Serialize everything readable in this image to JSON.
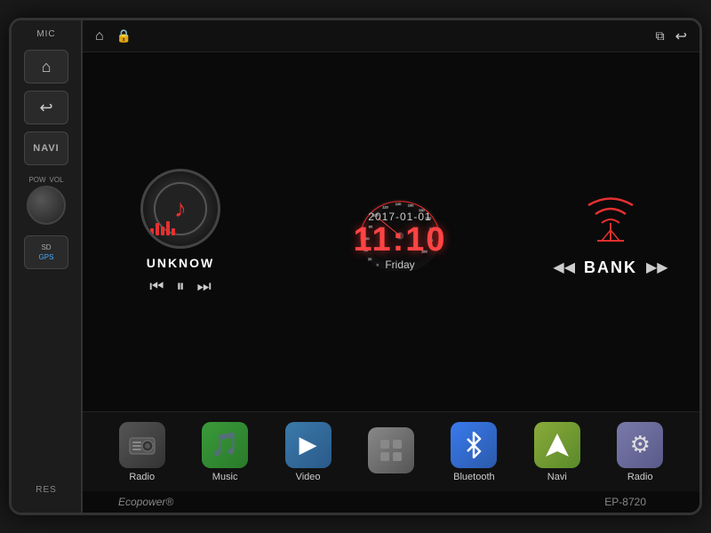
{
  "device": {
    "brand": "Ecopower®",
    "model": "EP-8720"
  },
  "topbar": {
    "left_icons": [
      "⌂",
      "🔒"
    ],
    "right_icons": [
      "⧉",
      "↩"
    ]
  },
  "music": {
    "track_name": "UNKNOW",
    "controls": {
      "prev": "⏮",
      "play": "⏸",
      "next": "⏭"
    }
  },
  "clock": {
    "date": "2017-01-01",
    "time": "11:10",
    "day": "Friday"
  },
  "radio": {
    "station": "BANK",
    "prev": "◀◀",
    "next": "▶▶"
  },
  "apps": [
    {
      "id": "radio",
      "label": "Radio",
      "icon": "📻"
    },
    {
      "id": "music",
      "label": "Music",
      "icon": "🎵"
    },
    {
      "id": "video",
      "label": "Video",
      "icon": "📹"
    },
    {
      "id": "apps",
      "label": "",
      "icon": "⊞"
    },
    {
      "id": "bluetooth",
      "label": "Bluetooth",
      "icon": "⚡"
    },
    {
      "id": "navi",
      "label": "Navi",
      "icon": "🧭"
    },
    {
      "id": "settings",
      "label": "Radio",
      "icon": "⚙"
    }
  ],
  "sidebar": {
    "mic_label": "MIC",
    "home_icon": "⌂",
    "back_icon": "↩",
    "navi_label": "NAVI",
    "pow_label": "POW",
    "vol_label": "VOL",
    "sd_label": "SD",
    "gps_label": "GPS",
    "res_label": "RES"
  },
  "colors": {
    "accent_red": "#e63030",
    "bg_dark": "#0a0a0a",
    "panel_bg": "#1c1c1c"
  }
}
